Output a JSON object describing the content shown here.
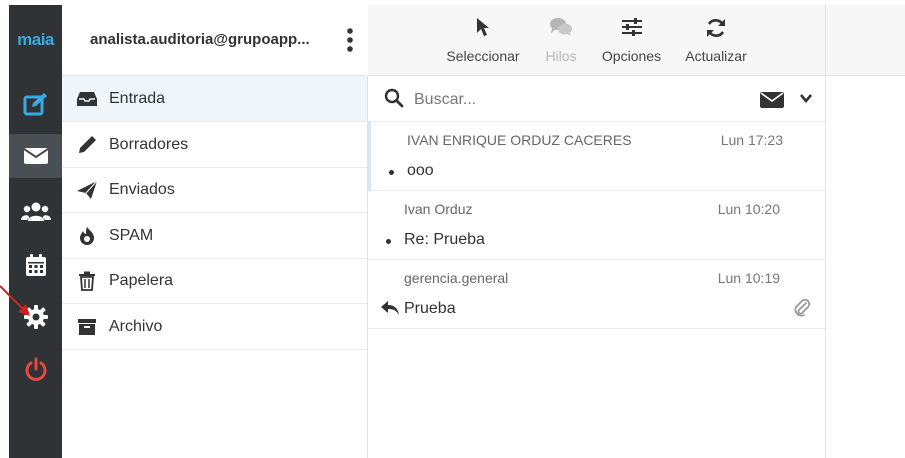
{
  "app": {
    "logo": "maia",
    "account": "analista.auditoria@grupoapp..."
  },
  "rail": {
    "items": [
      {
        "icon": "compose-icon",
        "color": "#39a9e1"
      },
      {
        "icon": "mail-icon",
        "active": true
      },
      {
        "icon": "contacts-icon"
      },
      {
        "icon": "calendar-icon"
      },
      {
        "icon": "settings-gear-icon"
      },
      {
        "icon": "power-icon",
        "color": "#e34a3c"
      }
    ]
  },
  "folders": [
    {
      "label": "Entrada",
      "icon": "inbox-icon",
      "selected": true
    },
    {
      "label": "Borradores",
      "icon": "pencil-icon"
    },
    {
      "label": "Enviados",
      "icon": "paper-plane-icon"
    },
    {
      "label": "SPAM",
      "icon": "fire-icon"
    },
    {
      "label": "Papelera",
      "icon": "trash-icon"
    },
    {
      "label": "Archivo",
      "icon": "archive-box-icon"
    }
  ],
  "toolbar": {
    "select_label": "Seleccionar",
    "threads_label": "Hilos",
    "options_label": "Opciones",
    "refresh_label": "Actualizar"
  },
  "search": {
    "placeholder": "Buscar..."
  },
  "messages": [
    {
      "from": "IVAN ENRIQUE ORDUZ CACERES",
      "time": "Lun 17:23",
      "subject": "ooo",
      "unread": true
    },
    {
      "from": "Ivan Orduz",
      "time": "Lun 10:20",
      "subject": "Re: Prueba",
      "unread": true
    },
    {
      "from": "gerencia.general",
      "time": "Lun 10:19",
      "subject": "Prueba",
      "replied": true,
      "attachment": true
    }
  ],
  "colors": {
    "rail_bg": "#2f3336",
    "accent": "#39a9e1",
    "danger": "#e34a3c"
  }
}
